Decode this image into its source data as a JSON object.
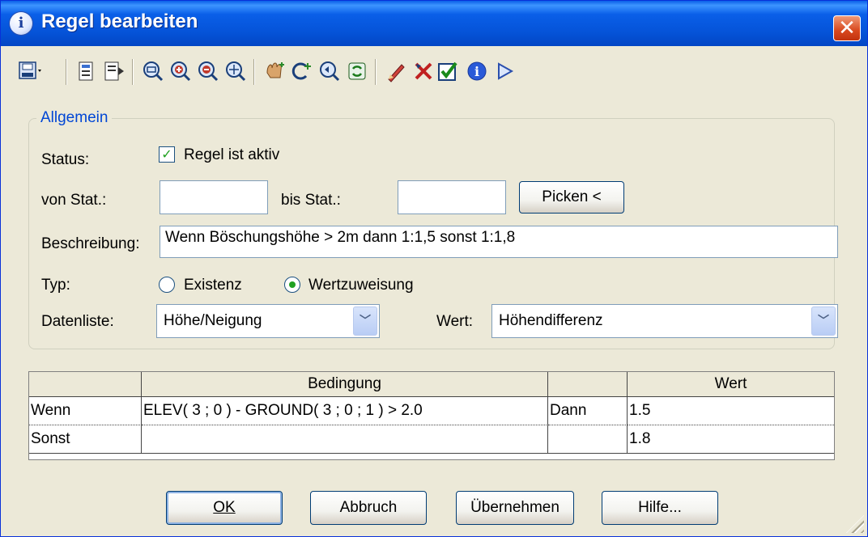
{
  "window": {
    "title": "Regel bearbeiten",
    "title_icon": "info-icon",
    "close_label": "✕"
  },
  "toolbar": {
    "icons": [
      "save-dropdown-icon",
      "copy-page-icon",
      "insert-page-icon",
      "zoom-extents-icon",
      "zoom-in-icon",
      "zoom-out-icon",
      "zoom-window-icon",
      "pan-hand-icon",
      "add-pick-icon",
      "zoom-previous-icon",
      "refresh-icon",
      "pencil-edit-icon",
      "delete-tools-icon",
      "check-validate-icon",
      "info-icon",
      "play-icon"
    ]
  },
  "general": {
    "group_label": "Allgemein",
    "status_label": "Status:",
    "active_checkbox_label": "Regel ist aktiv",
    "active_checked": true,
    "from_station_label": "von Stat.:",
    "from_station_value": "",
    "to_station_label": "bis Stat.:",
    "to_station_value": "",
    "pick_button": "Picken <",
    "description_label": "Beschreibung:",
    "description_value": "Wenn Böschungshöhe > 2m dann 1:1,5 sonst 1:1,8",
    "type_label": "Typ:",
    "type_options": [
      "Existenz",
      "Wertzuweisung"
    ],
    "type_selected": "Wertzuweisung",
    "datalist_label": "Datenliste:",
    "datalist_value": "Höhe/Neigung",
    "value_label": "Wert:",
    "value_value": "Höhendifferenz"
  },
  "rules_table": {
    "headers": [
      "",
      "Bedingung",
      "",
      "Wert"
    ],
    "rows": [
      [
        "Wenn",
        "ELEV( 3 ; 0 ) - GROUND( 3 ; 0 ; 1 ) > 2.0",
        "Dann",
        "1.5"
      ],
      [
        "Sonst",
        "",
        "",
        "1.8"
      ]
    ]
  },
  "buttons": {
    "ok": "OK",
    "cancel": "Abbruch",
    "apply": "Übernehmen",
    "help": "Hilfe..."
  },
  "colors": {
    "titlebar": "#0a5fe8",
    "dialog_bg": "#ece9d8",
    "group_label": "#0046d5",
    "check_green": "#21a121"
  }
}
